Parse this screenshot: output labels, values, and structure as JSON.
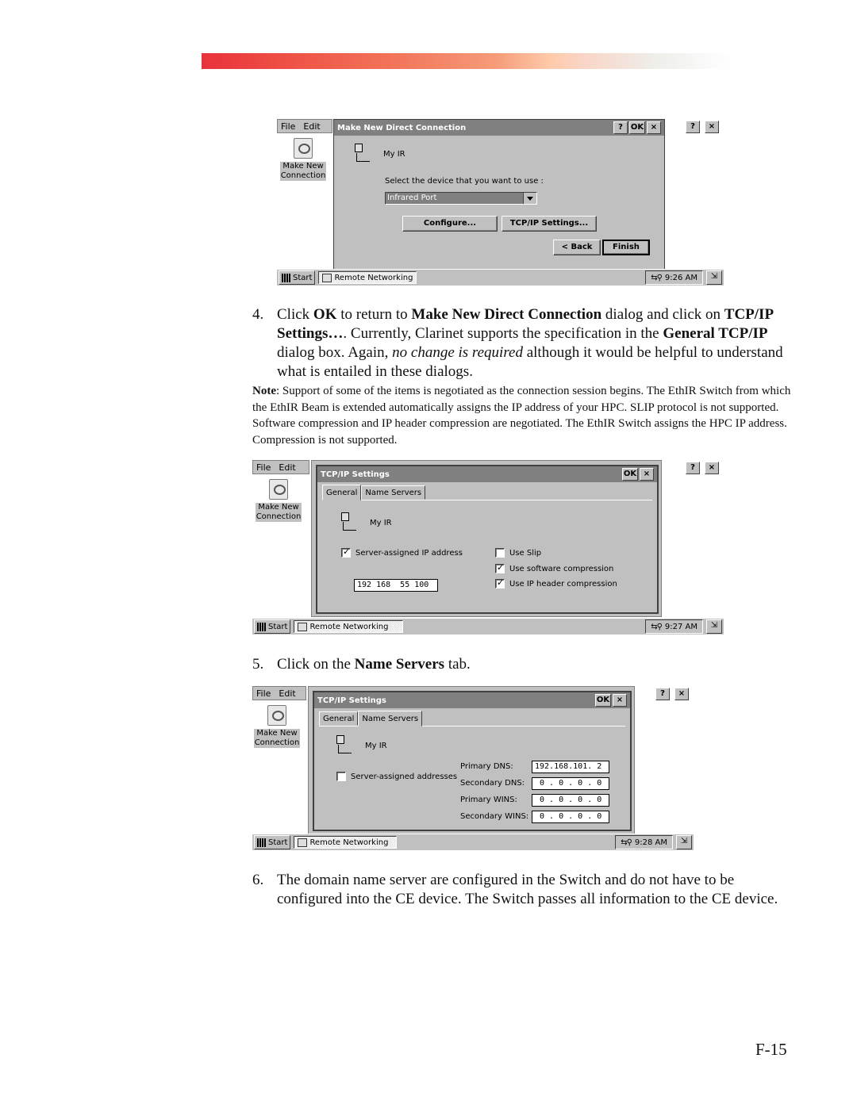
{
  "banner": {
    "colors": [
      "#e8323a",
      "#f27258",
      "#ffc9a8",
      "#eeeeea",
      "#ffffff"
    ]
  },
  "screens": [
    {
      "menu": {
        "file": "File",
        "edit": "Edit"
      },
      "desktop_icon": {
        "label_line1": "Make New",
        "label_line2": "Connection"
      },
      "outer_buttons": {
        "help": "?",
        "close": "×"
      },
      "dialog": {
        "title": "Make New Direct Connection",
        "buttons": {
          "help": "?",
          "ok": "OK",
          "close": "×"
        },
        "connection_name": "My IR",
        "device_prompt": "Select the device that you want to use :",
        "device_selected": "Infrared Port",
        "configure_button": "Configure...",
        "tcpip_button": "TCP/IP Settings...",
        "back_button": "< Back",
        "finish_button": "Finish"
      },
      "taskbar": {
        "start": "Start",
        "task": "Remote Networking",
        "time": "9:26 AM"
      }
    },
    {
      "menu": {
        "file": "File",
        "edit": "Edit"
      },
      "desktop_icon": {
        "label_line1": "Make New",
        "label_line2": "Connection"
      },
      "outer_buttons": {
        "help": "?",
        "close": "×"
      },
      "dialog": {
        "title": "TCP/IP Settings",
        "buttons": {
          "ok": "OK",
          "close": "×"
        },
        "tabs": [
          "General",
          "Name Servers"
        ],
        "active_tab": "General",
        "connection_name": "My IR",
        "server_assigned_ip": {
          "label": "Server-assigned IP address",
          "checked": true
        },
        "ip_address": "192 168  55 100",
        "use_slip": {
          "label": "Use Slip",
          "checked": false
        },
        "use_software_compression": {
          "label": "Use software compression",
          "checked": true
        },
        "use_ip_header_compression": {
          "label": "Use IP header compression",
          "checked": true
        }
      },
      "taskbar": {
        "start": "Start",
        "task": "Remote Networking",
        "time": "9:27 AM"
      }
    },
    {
      "menu": {
        "file": "File",
        "edit": "Edit"
      },
      "desktop_icon": {
        "label_line1": "Make New",
        "label_line2": "Connection"
      },
      "outer_buttons": {
        "help": "?",
        "close": "×"
      },
      "dialog": {
        "title": "TCP/IP Settings",
        "buttons": {
          "ok": "OK",
          "close": "×"
        },
        "tabs": [
          "General",
          "Name Servers"
        ],
        "active_tab": "Name Servers",
        "connection_name": "My IR",
        "server_assigned_addresses": {
          "label": "Server-assigned addresses",
          "checked": false
        },
        "primary_dns": {
          "label": "Primary DNS:",
          "value": "192.168.101. 2"
        },
        "secondary_dns": {
          "label": "Secondary DNS:",
          "value": " 0 . 0 . 0 . 0"
        },
        "primary_wins": {
          "label": "Primary WINS:",
          "value": " 0 . 0 . 0 . 0"
        },
        "secondary_wins": {
          "label": "Secondary WINS:",
          "value": " 0 . 0 . 0 . 0"
        }
      },
      "taskbar": {
        "start": "Start",
        "task": "Remote Networking",
        "time": "9:28 AM"
      }
    }
  ],
  "steps": {
    "step4": {
      "number": "4.",
      "t1": "Click ",
      "b1": "OK",
      "t2": " to return to ",
      "b2": "Make New Direct Connection",
      "t3": " dialog and click on ",
      "b3": "TCP/IP Settings…",
      "t4": ".  Currently, Clarinet supports the specification in the ",
      "b4": "General TCP/IP",
      "t5": " dialog box.  Again, ",
      "i1": "no change is required",
      "t6": " although it would be helpful to understand what is entailed in these dialogs."
    },
    "note": {
      "label": "Note",
      "text": ":  Support of some of the items is negotiated as the connection session begins.  The EthIR Switch from which the EthIR Beam is extended automatically assigns the IP address of your HPC.  SLIP protocol is not supported.  Software compression and IP header compression are negotiated.  The EthIR Switch assigns the HPC IP address.  Compression is not supported."
    },
    "step5": {
      "number": "5.",
      "t1": "Click on the ",
      "b1": "Name Servers",
      "t2": " tab."
    },
    "step6": {
      "number": "6.",
      "text": "The domain name server are configured in the Switch and do not have to be configured into the CE device.  The Switch passes all information to the CE device."
    }
  },
  "page_number": "F-15"
}
